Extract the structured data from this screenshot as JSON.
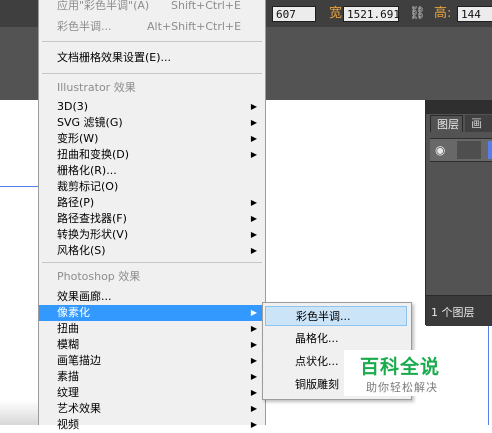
{
  "toolbar": {
    "x_value_partial": "607",
    "width_label": "宽:",
    "width_value": "1521.691",
    "link_icon": "chain-link-icon",
    "height_label": "高:",
    "height_value_partial": "144"
  },
  "menu": {
    "top_items": [
      {
        "label": "应用\"彩色半调\"(A)",
        "shortcut": "Shift+Ctrl+E",
        "disabled": true
      },
      {
        "label": "彩色半调...",
        "shortcut": "Alt+Shift+Ctrl+E",
        "disabled": true
      }
    ],
    "document_raster": "文档栅格效果设置(E)...",
    "illustrator_header": "Illustrator 效果",
    "illustrator_items": [
      {
        "label": "3D(3)",
        "submenu": true
      },
      {
        "label": "SVG 滤镜(G)",
        "submenu": true
      },
      {
        "label": "变形(W)",
        "submenu": true
      },
      {
        "label": "扭曲和变换(D)",
        "submenu": true
      },
      {
        "label": "栅格化(R)...",
        "submenu": false
      },
      {
        "label": "裁剪标记(O)",
        "submenu": false
      },
      {
        "label": "路径(P)",
        "submenu": true
      },
      {
        "label": "路径查找器(F)",
        "submenu": true
      },
      {
        "label": "转换为形状(V)",
        "submenu": true
      },
      {
        "label": "风格化(S)",
        "submenu": true
      }
    ],
    "photoshop_header": "Photoshop 效果",
    "photoshop_items": [
      {
        "label": "效果画廊...",
        "submenu": false,
        "selected": false
      },
      {
        "label": "像素化",
        "submenu": true,
        "selected": true
      },
      {
        "label": "扭曲",
        "submenu": true,
        "selected": false
      },
      {
        "label": "模糊",
        "submenu": true,
        "selected": false
      },
      {
        "label": "画笔描边",
        "submenu": true,
        "selected": false
      },
      {
        "label": "素描",
        "submenu": true,
        "selected": false
      },
      {
        "label": "纹理",
        "submenu": true,
        "selected": false
      },
      {
        "label": "艺术效果",
        "submenu": true,
        "selected": false
      },
      {
        "label": "视频",
        "submenu": true,
        "selected": false
      }
    ]
  },
  "submenu": {
    "items": [
      {
        "label": "彩色半调...",
        "highlighted": true
      },
      {
        "label": "晶格化...",
        "highlighted": false
      },
      {
        "label": "点状化...",
        "highlighted": false
      },
      {
        "label": "铜版雕刻",
        "highlighted": false
      }
    ]
  },
  "layers_panel": {
    "tab_layers": "图层",
    "tab_artboards": "画",
    "visibility_icon": "eye-icon",
    "layer_count": "1 个图层"
  },
  "watermark": {
    "main": "百科全说",
    "sub": "助你轻松解决"
  },
  "colors": {
    "selection": "#3399ff",
    "guide": "#5a7ee8",
    "label_accent": "#e6a23c",
    "watermark": "#1aab4d"
  }
}
